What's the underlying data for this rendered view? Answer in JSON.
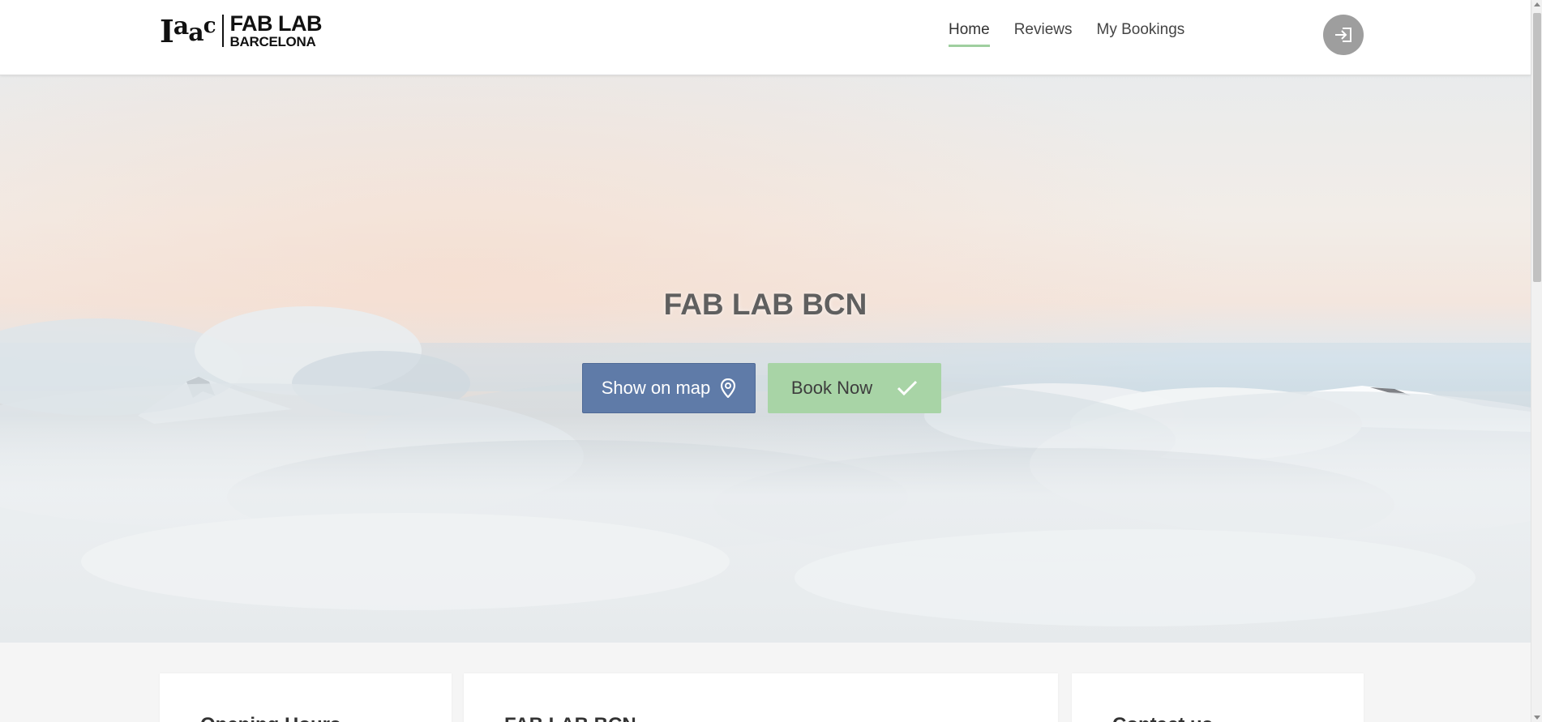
{
  "header": {
    "logo": {
      "iaac_letters": [
        "I",
        "a",
        "a",
        "c"
      ],
      "line1": "FAB LAB",
      "line2": "BARCELONA"
    },
    "nav": [
      {
        "label": "Home",
        "active": true
      },
      {
        "label": "Reviews",
        "active": false
      },
      {
        "label": "My Bookings",
        "active": false
      }
    ],
    "login_icon": "login-arrow-icon"
  },
  "hero": {
    "title": "FAB LAB BCN",
    "buttons": {
      "map_label": "Show on map",
      "map_icon": "map-pin-icon",
      "book_label": "Book Now",
      "book_icon": "checkmark-icon"
    }
  },
  "cards": [
    {
      "title": "Opening Hours"
    },
    {
      "title": "FAB LAB BCN"
    },
    {
      "title": "Contact us"
    }
  ],
  "colors": {
    "map_button": "#5f7ba8",
    "book_button": "#a8d4a6",
    "nav_active_underline": "#9fcf9f",
    "login_button": "#9e9e9e"
  }
}
